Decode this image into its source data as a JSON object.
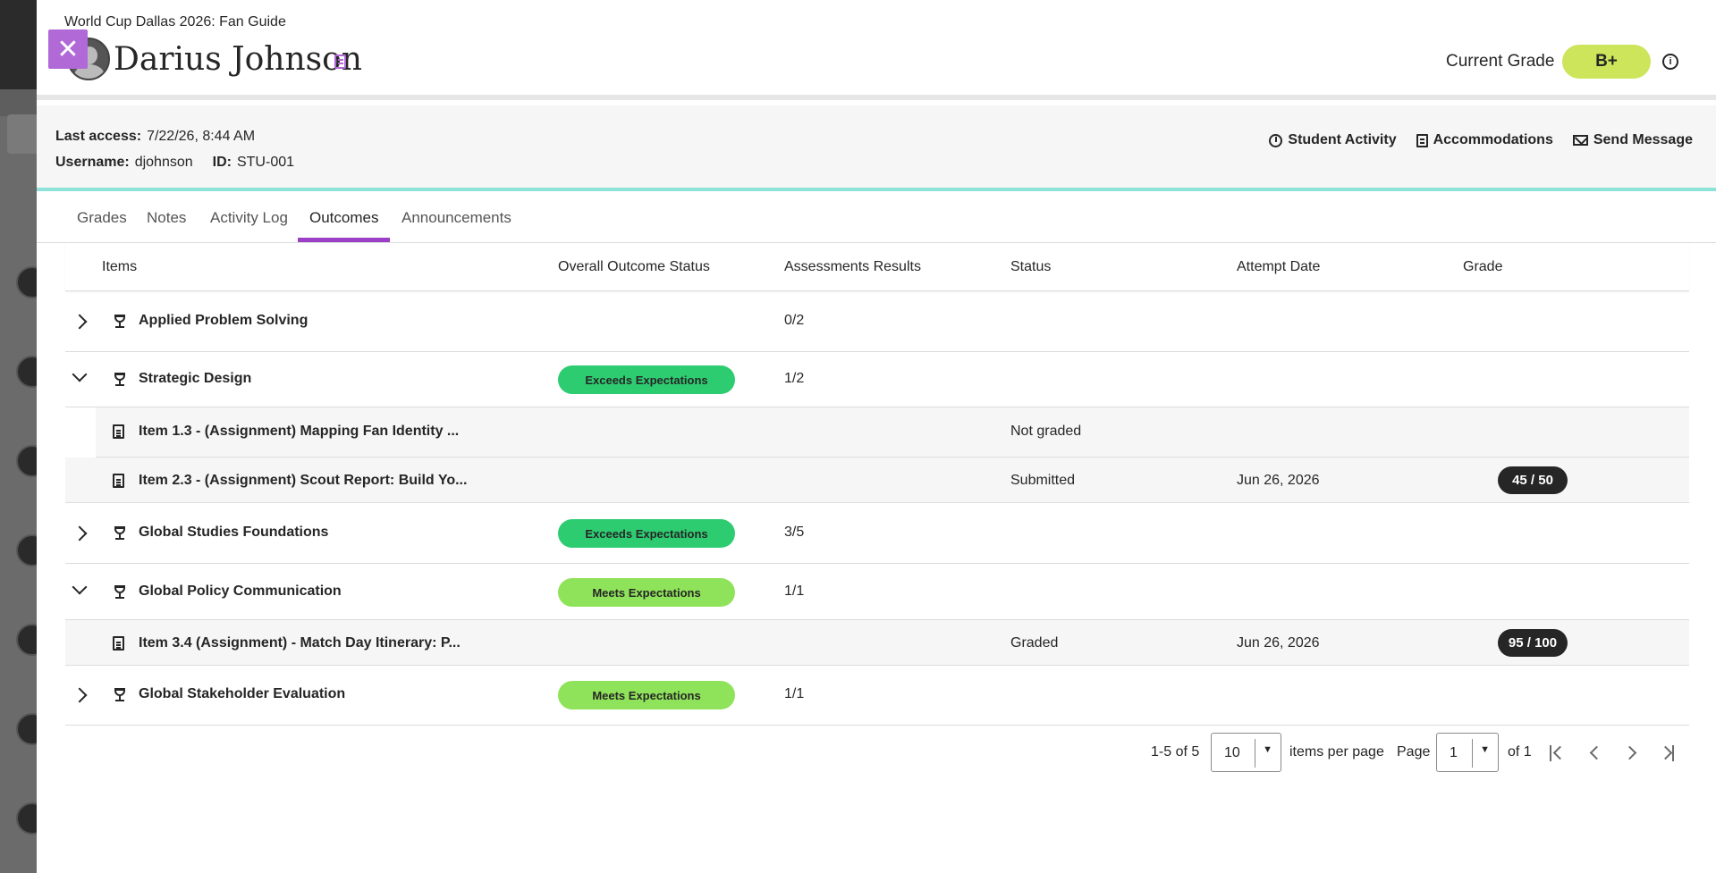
{
  "header": {
    "course_title": "World Cup Dallas 2026: Fan Guide",
    "student_name": "Darius Johnson",
    "current_grade_label": "Current Grade",
    "current_grade": "B+",
    "info_glyph": "i",
    "close_glyph": "✕"
  },
  "student_info": {
    "last_access_label": "Last access:",
    "last_access": "7/22/26, 8:44 AM",
    "username_label": "Username:",
    "username": "djohnson",
    "id_label": "ID:",
    "id": "STU-001"
  },
  "actions": {
    "activity": "Student Activity",
    "accommodations": "Accommodations",
    "message": "Send Message"
  },
  "tabs": [
    {
      "label": "Grades"
    },
    {
      "label": "Notes"
    },
    {
      "label": "Activity Log"
    },
    {
      "label": "Outcomes",
      "active": true
    },
    {
      "label": "Announcements"
    }
  ],
  "columns": [
    "Items",
    "Overall Outcome Status",
    "Assessments Results",
    "Status",
    "Attempt Date",
    "Grade"
  ],
  "rows": [
    {
      "title": "Applied Problem Solving",
      "results": "0/2"
    },
    {
      "title": "Strategic Design",
      "outcome": "Exceeds Expectations",
      "results": "1/2"
    },
    {
      "title": "Item 1.3 - (Assignment) Mapping Fan Identity ...",
      "status": "Not graded"
    },
    {
      "title": "Item 2.3 - (Assignment) Scout Report: Build Yo...",
      "status": "Submitted",
      "date": "Jun 26, 2026",
      "grade": "45 / 50"
    },
    {
      "title": "Global Studies Foundations",
      "outcome": "Exceeds Expectations",
      "results": "3/5"
    },
    {
      "title": "Global Policy Communication",
      "outcome": "Meets Expectations",
      "results": "1/1"
    },
    {
      "title": "Item 3.4 (Assignment) - Match Day Itinerary: P...",
      "status": "Graded",
      "date": "Jun 26, 2026",
      "grade": "95 / 100"
    },
    {
      "title": "Global Stakeholder Evaluation",
      "outcome": "Meets Expectations",
      "results": "1/1"
    }
  ],
  "pagination": {
    "range": "1-5 of 5",
    "per_page": "10",
    "per_page_label": "items per page",
    "page_label": "Page",
    "page": "1",
    "of_label": "of 1",
    "dropdown_glyph": "▼"
  },
  "colors": {
    "accent": "#9b3fc6",
    "close_button": "#b069d6",
    "grade_pill": "#cde55a",
    "exceeds": "#2ecc71",
    "meets": "#8fe35a",
    "divider": "#8ee3d8"
  }
}
